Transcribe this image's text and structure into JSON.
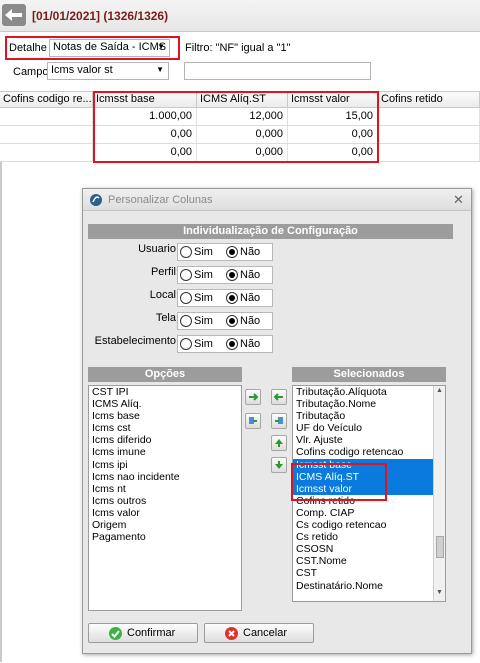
{
  "header": {
    "record_title": "[01/01/2021] (1326/1326)"
  },
  "filter": {
    "detalhe_label": "Detalhe",
    "detalhe_value": "Notas de Saída - ICMS",
    "filtro_text": "Filtro: \"NF\" igual a \"1\"",
    "campo_label": "Campo",
    "campo_value": "Icms valor st",
    "campo_search_value": ""
  },
  "grid": {
    "columns": [
      "Cofins codigo re...",
      "Icmsst base",
      "ICMS Alíq.ST",
      "Icmsst valor",
      "Cofins retido"
    ],
    "rows": [
      [
        "",
        "1.000,00",
        "12,000",
        "15,00",
        ""
      ],
      [
        "",
        "0,00",
        "0,000",
        "0,00",
        ""
      ],
      [
        "",
        "0,00",
        "0,000",
        "0,00",
        ""
      ]
    ]
  },
  "dialog": {
    "title": "Personalizar Colunas",
    "config_header": "Individualização de Configuração",
    "config_rows": [
      {
        "label": "Usuario",
        "opt1": "Sim",
        "opt2": "Não",
        "selected": "Não"
      },
      {
        "label": "Perfil",
        "opt1": "Sim",
        "opt2": "Não",
        "selected": "Não"
      },
      {
        "label": "Local",
        "opt1": "Sim",
        "opt2": "Não",
        "selected": "Não"
      },
      {
        "label": "Tela",
        "opt1": "Sim",
        "opt2": "Não",
        "selected": "Não"
      },
      {
        "label": "Estabelecimento",
        "opt1": "Sim",
        "opt2": "Não",
        "selected": "Não"
      }
    ],
    "opcoes_header": "Opções",
    "opcoes_items": [
      "CST IPI",
      "ICMS Alíq.",
      "Icms base",
      "Icms cst",
      "Icms diferido",
      "Icms imune",
      "Icms ipi",
      "Icms nao incidente",
      "Icms nt",
      "Icms outros",
      "Icms valor",
      "Origem",
      "Pagamento"
    ],
    "selecionados_header": "Selecionados",
    "selecionados_items": [
      "Tributação.Alíquota",
      "Tributação.Nome",
      "Tributação",
      "UF do Veículo",
      "Vlr. Ajuste",
      "Cofins codigo retencao",
      "Icmsst base",
      "ICMS Alíq.ST",
      "Icmsst valor",
      "Cofins retido",
      "Comp. CIAP",
      "Cs codigo retencao",
      "Cs retido",
      "CSOSN",
      "CST.Nome",
      "CST",
      "Destinatário.Nome"
    ],
    "selected_indices": [
      6,
      7,
      8
    ],
    "confirm_label": "Confirmar",
    "cancel_label": "Cancelar"
  },
  "colors": {
    "title_red": "#7a1c1c",
    "highlight_border": "#e0141e",
    "selection_blue": "#0a7adf",
    "section_gray": "#9c9c9c"
  },
  "icons": [
    "back-arrow-icon",
    "dropdown-arrow-icon",
    "add-right-icon",
    "remove-left-icon",
    "move-up-icon",
    "move-down-icon",
    "confirm-check-icon",
    "cancel-x-icon",
    "close-icon",
    "app-logo-icon"
  ]
}
